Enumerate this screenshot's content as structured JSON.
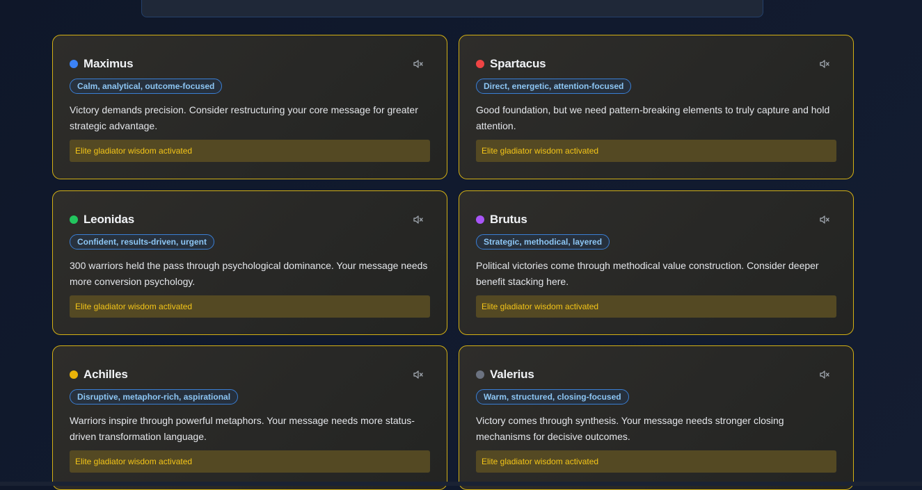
{
  "mute_icon": "speaker-muted-icon",
  "cards": [
    {
      "name": "Maximus",
      "dot_color": "#3b82f6",
      "tag": "Calm, analytical, outcome-focused",
      "message": "Victory demands precision. Consider restructuring your core message for greater strategic advantage.",
      "status": "Elite gladiator wisdom activated"
    },
    {
      "name": "Spartacus",
      "dot_color": "#ef4444",
      "tag": "Direct, energetic, attention-focused",
      "message": "Good foundation, but we need pattern-breaking elements to truly capture and hold attention.",
      "status": "Elite gladiator wisdom activated"
    },
    {
      "name": "Leonidas",
      "dot_color": "#22c55e",
      "tag": "Confident, results-driven, urgent",
      "message": "300 warriors held the pass through psychological dominance. Your message needs more conversion psychology.",
      "status": "Elite gladiator wisdom activated"
    },
    {
      "name": "Brutus",
      "dot_color": "#a855f7",
      "tag": "Strategic, methodical, layered",
      "message": "Political victories come through methodical value construction. Consider deeper benefit stacking here.",
      "status": "Elite gladiator wisdom activated"
    },
    {
      "name": "Achilles",
      "dot_color": "#eab308",
      "tag": "Disruptive, metaphor-rich, aspirational",
      "message": "Warriors inspire through powerful metaphors. Your message needs more status-driven transformation language.",
      "status": "Elite gladiator wisdom activated"
    },
    {
      "name": "Valerius",
      "dot_color": "#6b7280",
      "tag": "Warm, structured, closing-focused",
      "message": "Victory comes through synthesis. Your message needs stronger closing mechanisms for decisive outcomes.",
      "status": "Elite gladiator wisdom activated"
    }
  ]
}
